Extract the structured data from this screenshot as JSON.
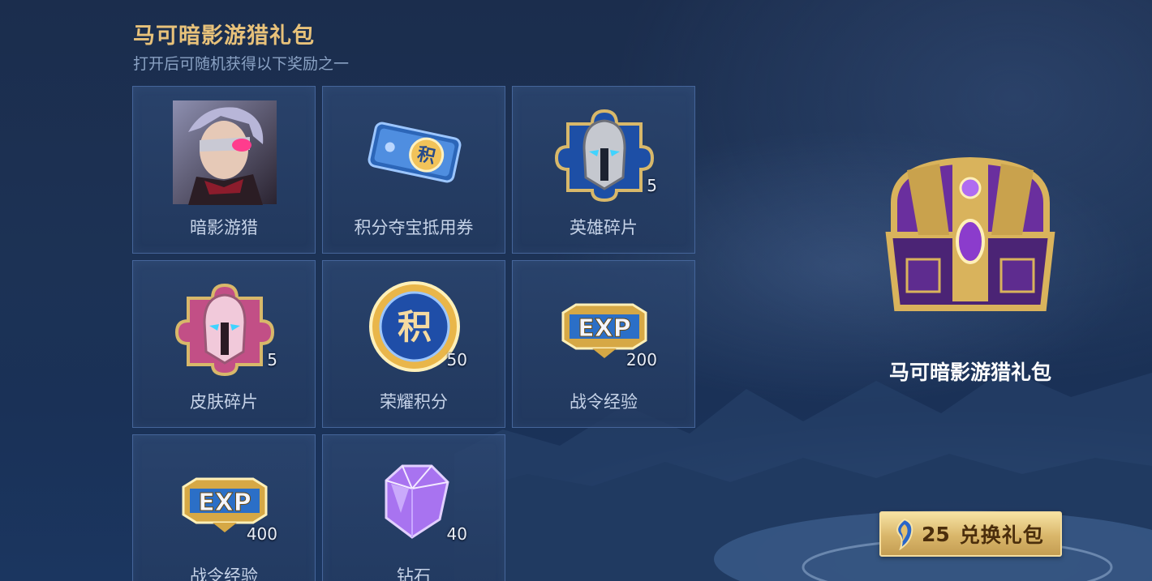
{
  "header": {
    "title": "马可暗影游猎礼包",
    "subtitle": "打开后可随机获得以下奖励之一"
  },
  "rewards": [
    {
      "label": "暗影游猎",
      "count": "",
      "icon": "hero-skin-portrait-icon"
    },
    {
      "label": "积分夺宝抵用券",
      "count": "",
      "icon": "ticket-icon"
    },
    {
      "label": "英雄碎片",
      "count": "5",
      "icon": "hero-fragment-icon"
    },
    {
      "label": "皮肤碎片",
      "count": "5",
      "icon": "skin-fragment-icon"
    },
    {
      "label": "荣耀积分",
      "count": "50",
      "icon": "glory-points-coin-icon"
    },
    {
      "label": "战令经验",
      "count": "200",
      "icon": "exp-badge-icon"
    },
    {
      "label": "战令经验",
      "count": "400",
      "icon": "exp-badge-icon"
    },
    {
      "label": "钻石",
      "count": "40",
      "icon": "diamond-icon"
    }
  ],
  "package": {
    "name": "马可暗影游猎礼包",
    "icon": "treasure-chest-icon"
  },
  "redeem": {
    "cost": "25",
    "label": "兑换礼包",
    "icon": "gold-token-icon"
  },
  "colors": {
    "title_gold": "#e8c27a",
    "subtitle": "#8aa2c4",
    "card_border": "#45659a",
    "button_gold": "#d9b66a"
  }
}
